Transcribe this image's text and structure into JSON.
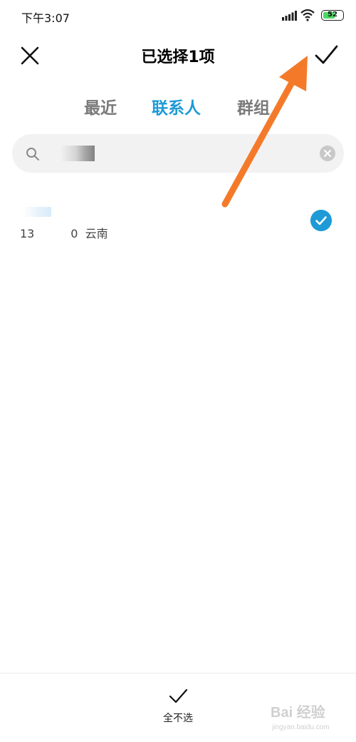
{
  "status_bar": {
    "time": "下午3:07",
    "battery": "52",
    "battery_color": "#4cd964",
    "icons": [
      "signal-icon",
      "wifi-icon",
      "battery-icon"
    ]
  },
  "header": {
    "title": "已选择1项",
    "close_icon": "close-icon",
    "confirm_icon": "checkmark-icon"
  },
  "tabs": [
    {
      "label": "最近",
      "active": false
    },
    {
      "label": "联系人",
      "active": true
    },
    {
      "label": "群组",
      "active": false
    }
  ],
  "accent_color": "#1e9bd6",
  "search": {
    "value": "",
    "icon": "search-icon",
    "clear_icon": "clear-icon"
  },
  "contacts": [
    {
      "name": "",
      "detail": "13          0  云南",
      "selected": true
    }
  ],
  "annotation": {
    "arrow_color": "#f47a2a"
  },
  "bottom_bar": {
    "select_none_label": "全不选",
    "select_none_icon": "checkmark-icon"
  },
  "watermark": {
    "text": "Bai 经验",
    "sub": "jingyan.baidu.com"
  }
}
